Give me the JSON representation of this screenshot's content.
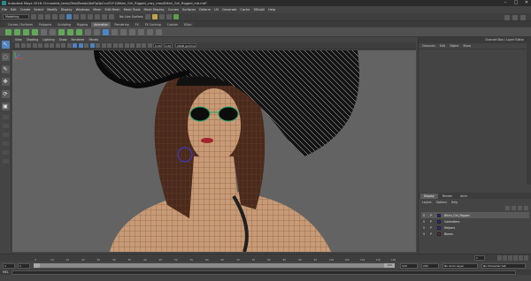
{
  "window": {
    "title": "Autodesk Maya 2016: D:\\models_temp\\Test\\Ready\\NePjp3pCcvZ2Y1\\Bikini_Girl_Rigged_vray_max\\Bikini_Girl_Rigged_mb.mb*",
    "controls": [
      "–",
      "□",
      "✕"
    ]
  },
  "menubar": [
    "File",
    "Edit",
    "Create",
    "Select",
    "Modify",
    "Display",
    "Windows",
    "Mesh",
    "Edit Mesh",
    "Mesh Tools",
    "Mesh Display",
    "Curves",
    "Surfaces",
    "Deform",
    "UV",
    "Generate",
    "Cache",
    "3DtoAll",
    "Help"
  ],
  "statusline": {
    "mode": "Modeling",
    "live_surface": "No Live Surface"
  },
  "shelf": {
    "tabs": [
      "Curves / Surfaces",
      "Polygons",
      "Sculpting",
      "Rigging",
      "Animation",
      "Rendering",
      "FX",
      "FX Caching",
      "Custom",
      "XGen"
    ],
    "active_tab": "Animation"
  },
  "viewport": {
    "menu": [
      "View",
      "Shading",
      "Lighting",
      "Show",
      "Renderer",
      "Panels"
    ],
    "field_a": "0.00",
    "field_b": "1.00",
    "color_space": "sRGB gamma",
    "background_color": "#636363",
    "wire_color": "#7a4f2d",
    "hat_color": "#0d0d0d"
  },
  "channel_box": {
    "header": "Channel Box / Layer Editor",
    "tabs": [
      "Channels",
      "Edit",
      "Object",
      "Show"
    ]
  },
  "layer_editor": {
    "tabs": [
      "Display",
      "Render",
      "Anim"
    ],
    "active_tab": "Display",
    "menu": [
      "Layers",
      "Options",
      "Help"
    ],
    "layers": [
      {
        "v": "V",
        "p": "P",
        "color": "#1d1dc0",
        "name": "Bikini_Girl_Rigged",
        "selected": true
      },
      {
        "v": "V",
        "p": "P",
        "color": "#2424a8",
        "name": "Controllers",
        "selected": false
      },
      {
        "v": "V",
        "p": "P",
        "color": "#2a2ab8",
        "name": "Helpers",
        "selected": false
      },
      {
        "v": "V",
        "p": "P",
        "color": "#8a1a3a",
        "name": "Bones",
        "selected": false
      }
    ]
  },
  "timeline": {
    "tick_labels": [
      "5",
      "10",
      "15",
      "20",
      "25",
      "30",
      "35",
      "40",
      "45",
      "50",
      "55",
      "60",
      "65",
      "70",
      "75",
      "80",
      "85",
      "90",
      "95",
      "100",
      "105",
      "110",
      "115",
      "120"
    ],
    "current_frame": "1"
  },
  "range_slider": {
    "start": "1",
    "inner_start": "1",
    "inner_end": "120",
    "end_a": "120",
    "end_b": "200",
    "anim_layer": "No Anim Layer",
    "char_set": "No Character Set"
  },
  "command_line": {
    "label": "MEL"
  }
}
